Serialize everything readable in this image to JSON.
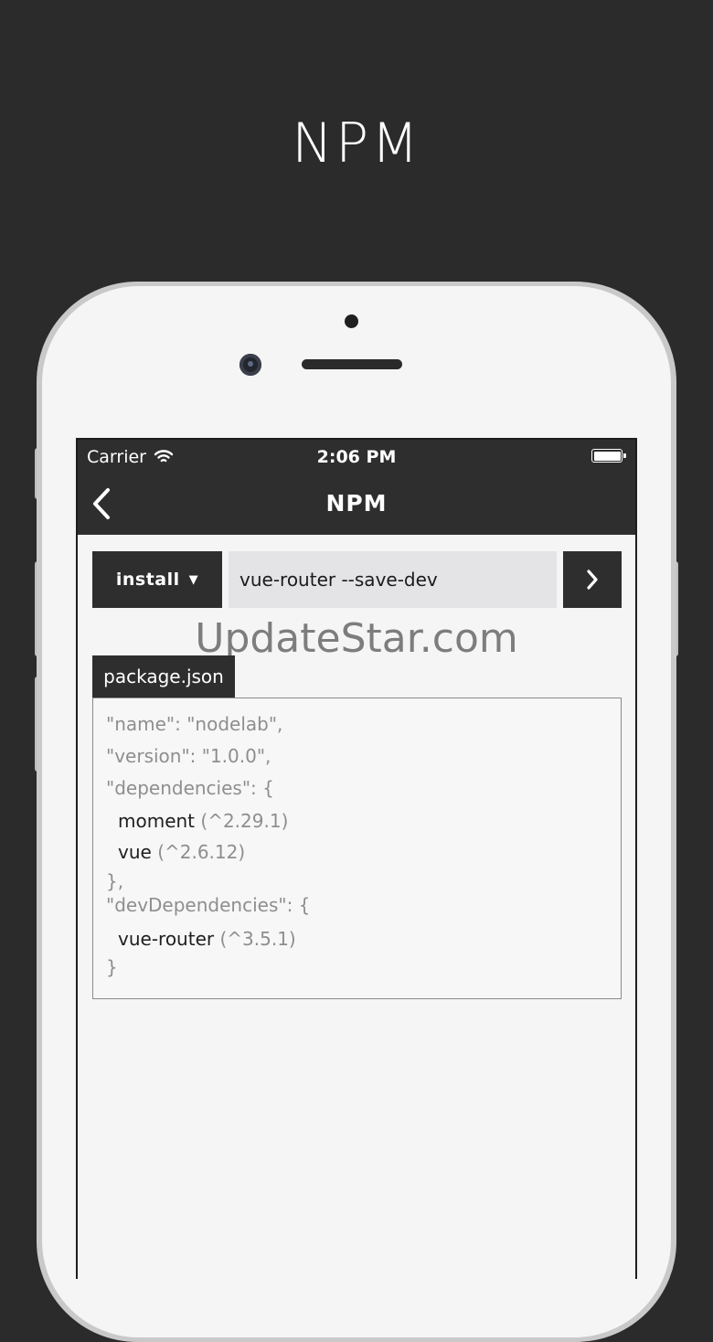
{
  "promo": {
    "title": "NPM"
  },
  "status_bar": {
    "carrier": "Carrier",
    "time": "2:06 PM"
  },
  "nav": {
    "title": "NPM"
  },
  "command": {
    "action": "install",
    "input_value": "vue-router --save-dev"
  },
  "watermark": "UpdateStar.com",
  "package": {
    "tab_label": "package.json",
    "name_line": "\"name\": \"nodelab\",",
    "version_line": "\"version\": \"1.0.0\",",
    "deps_open": "\"dependencies\": {",
    "dependencies": [
      {
        "name": "moment",
        "version": "(^2.29.1)"
      },
      {
        "name": "vue",
        "version": "(^2.6.12)"
      }
    ],
    "deps_close": "},",
    "devdeps_open": "\"devDependencies\": {",
    "dev_dependencies": [
      {
        "name": "vue-router",
        "version": "(^3.5.1)"
      }
    ],
    "devdeps_close": "}"
  },
  "icons": {
    "back": "chevron-left-icon",
    "run": "chevron-right-icon",
    "wifi": "wifi-icon",
    "battery": "battery-icon",
    "caret": "triangle-down-icon"
  },
  "colors": {
    "background": "#2b2b2b",
    "bar": "#2e2e2e",
    "input": "#e4e4e6",
    "muted_text": "#8e8e8e"
  }
}
